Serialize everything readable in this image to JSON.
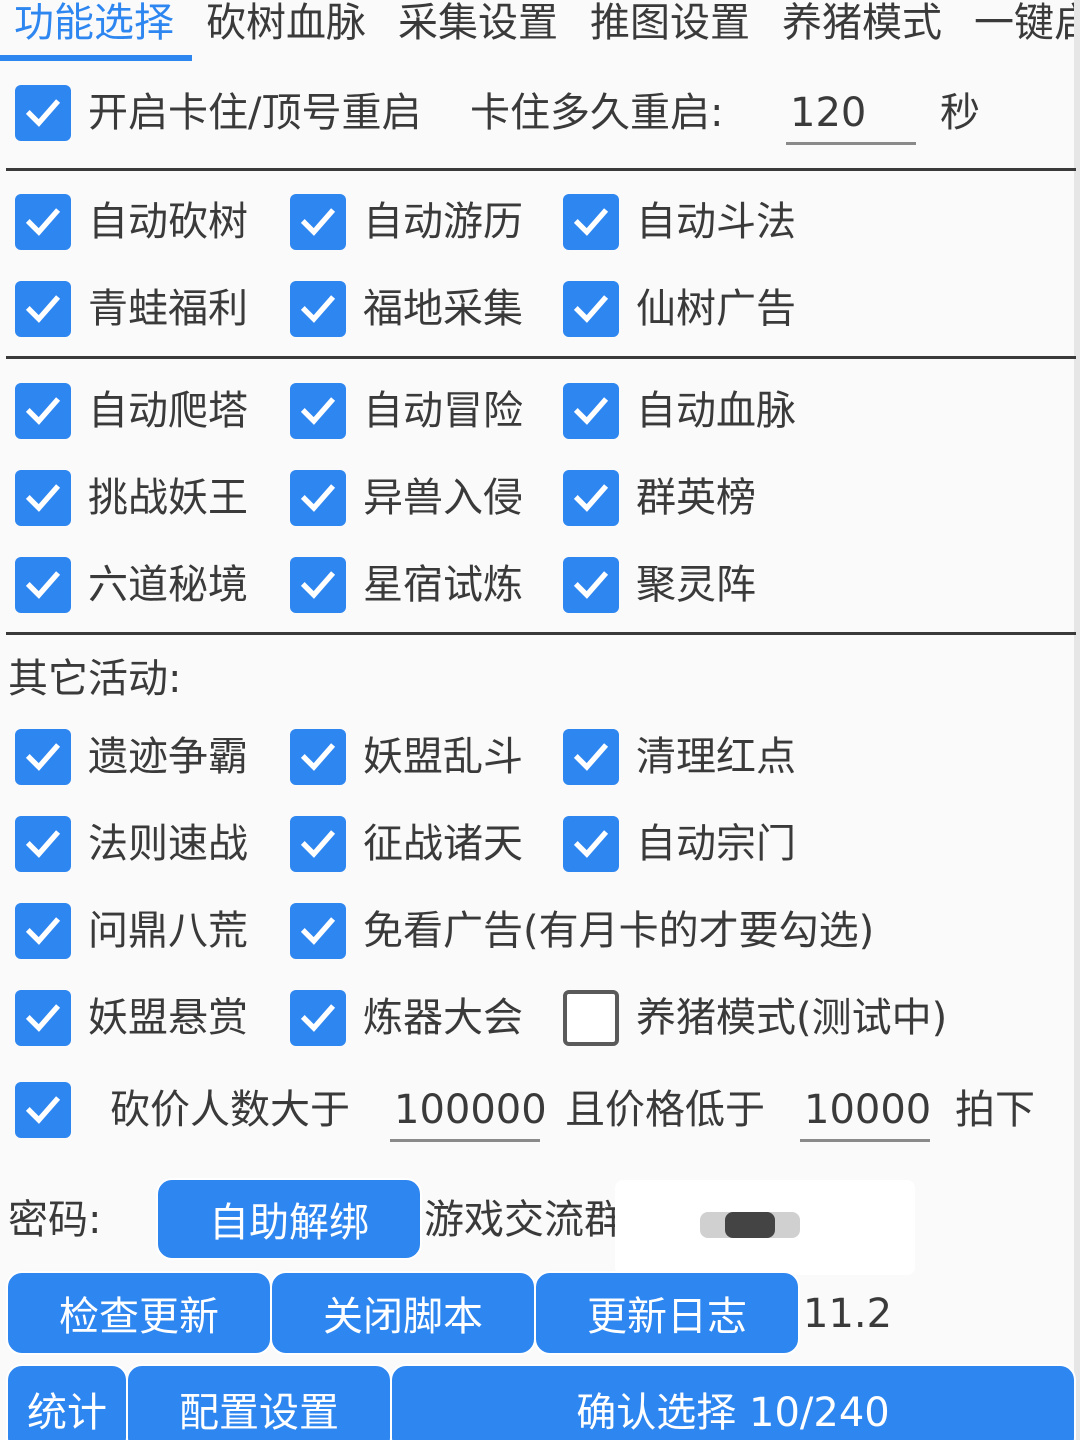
{
  "tabs": [
    {
      "label": "功能选择",
      "active": true
    },
    {
      "label": "砍树血脉",
      "active": false
    },
    {
      "label": "采集设置",
      "active": false
    },
    {
      "label": "推图设置",
      "active": false
    },
    {
      "label": "养猪模式",
      "active": false
    },
    {
      "label": "一键启",
      "active": false
    }
  ],
  "restart": {
    "checked": true,
    "label": "开启卡住/顶号重启",
    "delay_label": "卡住多久重启:",
    "delay_value": "120",
    "unit": "秒"
  },
  "group1": [
    {
      "label": "自动砍树",
      "checked": true
    },
    {
      "label": "自动游历",
      "checked": true
    },
    {
      "label": "自动斗法",
      "checked": true
    },
    {
      "label": "青蛙福利",
      "checked": true
    },
    {
      "label": "福地采集",
      "checked": true
    },
    {
      "label": "仙树广告",
      "checked": true
    }
  ],
  "group2": [
    {
      "label": "自动爬塔",
      "checked": true
    },
    {
      "label": "自动冒险",
      "checked": true
    },
    {
      "label": "自动血脉",
      "checked": true
    },
    {
      "label": "挑战妖王",
      "checked": true
    },
    {
      "label": "异兽入侵",
      "checked": true
    },
    {
      "label": "群英榜",
      "checked": true
    },
    {
      "label": "六道秘境",
      "checked": true
    },
    {
      "label": "星宿试炼",
      "checked": true
    },
    {
      "label": "聚灵阵",
      "checked": true
    }
  ],
  "other_title": "其它活动:",
  "group3": [
    {
      "label": "遗迹争霸",
      "checked": true
    },
    {
      "label": "妖盟乱斗",
      "checked": true
    },
    {
      "label": "清理红点",
      "checked": true
    },
    {
      "label": "法则速战",
      "checked": true
    },
    {
      "label": "征战诸天",
      "checked": true
    },
    {
      "label": "自动宗门",
      "checked": true
    },
    {
      "label": "问鼎八荒",
      "checked": true
    },
    {
      "label": "免看广告(有月卡的才要勾选)",
      "checked": true
    },
    {
      "label": "妖盟悬赏",
      "checked": true
    },
    {
      "label": "炼器大会",
      "checked": true
    },
    {
      "label": "养猪模式(测试中)",
      "checked": false
    }
  ],
  "auction": {
    "checked": true,
    "label_a": "砍价人数大于",
    "count_value": "100000",
    "label_b": "且价格低于",
    "price_value": "10000",
    "label_c": "拍下"
  },
  "password": {
    "label": "密码:",
    "unbind_button": "自助解绑",
    "group_label": "游戏交流群"
  },
  "buttons_row1": {
    "check_update": "检查更新",
    "close_script": "关闭脚本",
    "update_log": "更新日志",
    "version": "11.2"
  },
  "buttons_row2": {
    "stats": "统计",
    "config": "配置设置",
    "confirm": "确认选择 10/240"
  },
  "colors": {
    "accent": "#2e86f0",
    "text": "#3a3a3a",
    "background": "#fafafa"
  },
  "icons": {
    "check": "checkmark-icon"
  }
}
